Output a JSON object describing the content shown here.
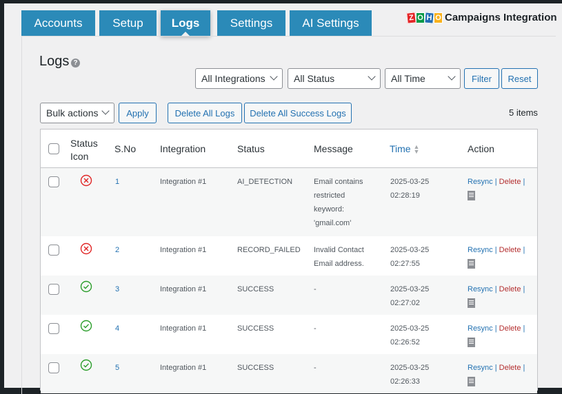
{
  "tabs": [
    {
      "label": "Accounts"
    },
    {
      "label": "Setup"
    },
    {
      "label": "Logs",
      "active": true
    },
    {
      "label": "Settings"
    },
    {
      "label": "AI Settings"
    }
  ],
  "brand": {
    "logo_letters": [
      "Z",
      "O",
      "H",
      "O"
    ],
    "title": "Campaigns Integration"
  },
  "page_title": "Logs",
  "help_icon": "?",
  "filters": {
    "integration": "All Integrations",
    "status": "All Status",
    "time": "All Time",
    "filter_label": "Filter",
    "reset_label": "Reset"
  },
  "bulk": {
    "bulk_actions": "Bulk actions",
    "apply": "Apply",
    "delete_all": "Delete All Logs",
    "delete_success": "Delete All Success Logs",
    "items_count": "5 items"
  },
  "columns": {
    "status_icon_1": "Status",
    "status_icon_2": "Icon",
    "sno": "S.No",
    "integration": "Integration",
    "status": "Status",
    "message": "Message",
    "time": "Time",
    "action": "Action"
  },
  "actions": {
    "resync": "Resync",
    "delete": "Delete",
    "sep": "|"
  },
  "colors": {
    "error": "#e02424",
    "success": "#2a9d2a",
    "link": "#2271b1",
    "delete": "#b32d2e",
    "tab": "#2b8ab8"
  },
  "rows": [
    {
      "status": "error",
      "sno": "1",
      "integration": "Integration #1",
      "status_text": "AI_DETECTION",
      "message": [
        "Email contains",
        "restricted",
        "keyword:",
        "'gmail.com'"
      ],
      "date": "2025-03-25",
      "time": "02:28:19"
    },
    {
      "status": "error",
      "sno": "2",
      "integration": "Integration #1",
      "status_text": "RECORD_FAILED",
      "message": [
        "Invalid Contact",
        "Email address."
      ],
      "date": "2025-03-25",
      "time": "02:27:55"
    },
    {
      "status": "success",
      "sno": "3",
      "integration": "Integration #1",
      "status_text": "SUCCESS",
      "message": [
        "-"
      ],
      "date": "2025-03-25",
      "time": "02:27:02"
    },
    {
      "status": "success",
      "sno": "4",
      "integration": "Integration #1",
      "status_text": "SUCCESS",
      "message": [
        "-"
      ],
      "date": "2025-03-25",
      "time": "02:26:52"
    },
    {
      "status": "success",
      "sno": "5",
      "integration": "Integration #1",
      "status_text": "SUCCESS",
      "message": [
        "-"
      ],
      "date": "2025-03-25",
      "time": "02:26:33"
    }
  ]
}
